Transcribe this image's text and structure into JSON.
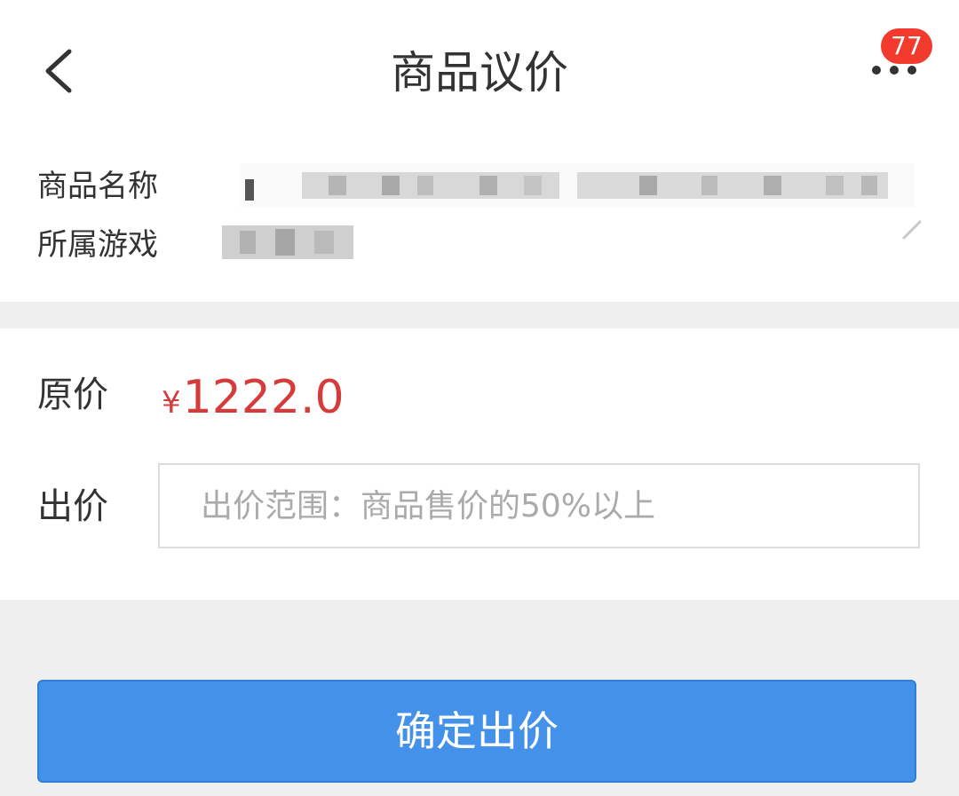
{
  "header": {
    "title": "商品议价",
    "back_icon": "chevron-left-icon",
    "more_icon": "more-dots-icon",
    "badge_count": "77"
  },
  "product_info": {
    "name_label": "商品名称",
    "game_label": "所属游戏"
  },
  "pricing": {
    "original_label": "原价",
    "currency_symbol": "¥",
    "original_price": "1222.0",
    "bid_label": "出价",
    "bid_placeholder": "出价范围：商品售价的50%以上",
    "bid_value": ""
  },
  "actions": {
    "confirm_label": "确定出价"
  },
  "colors": {
    "price": "#d63b3b",
    "primary_button": "#4391e8",
    "badge": "#f23a2d"
  }
}
